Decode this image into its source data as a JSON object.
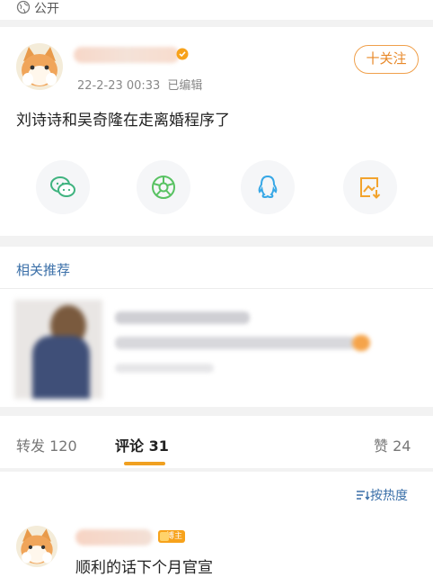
{
  "topbar": {
    "visibility": "公开"
  },
  "post": {
    "time": "22-2-23 00:33",
    "edited": "已编辑",
    "follow_label": "十关注",
    "text": "刘诗诗和吴奇隆在走离婚程序了",
    "share_icons": [
      "wechat-icon",
      "moments-icon",
      "qq-icon",
      "save-image-icon"
    ]
  },
  "related": {
    "title": "相关推荐"
  },
  "tabs": {
    "repost": "转发 120",
    "comments": "评论 31",
    "likes": "赞 24"
  },
  "comments": {
    "sort_label": "按热度",
    "badge_label": "博主",
    "items": [
      {
        "text": "顺利的话下个月官宣"
      }
    ]
  },
  "colors": {
    "accent_orange": "#f0a04b",
    "link_blue": "#3a6fa8",
    "wechat_green": "#3fb37f",
    "moments_green": "#58c262",
    "qq_blue": "#36a7e6",
    "save_orange": "#f2a32d"
  }
}
